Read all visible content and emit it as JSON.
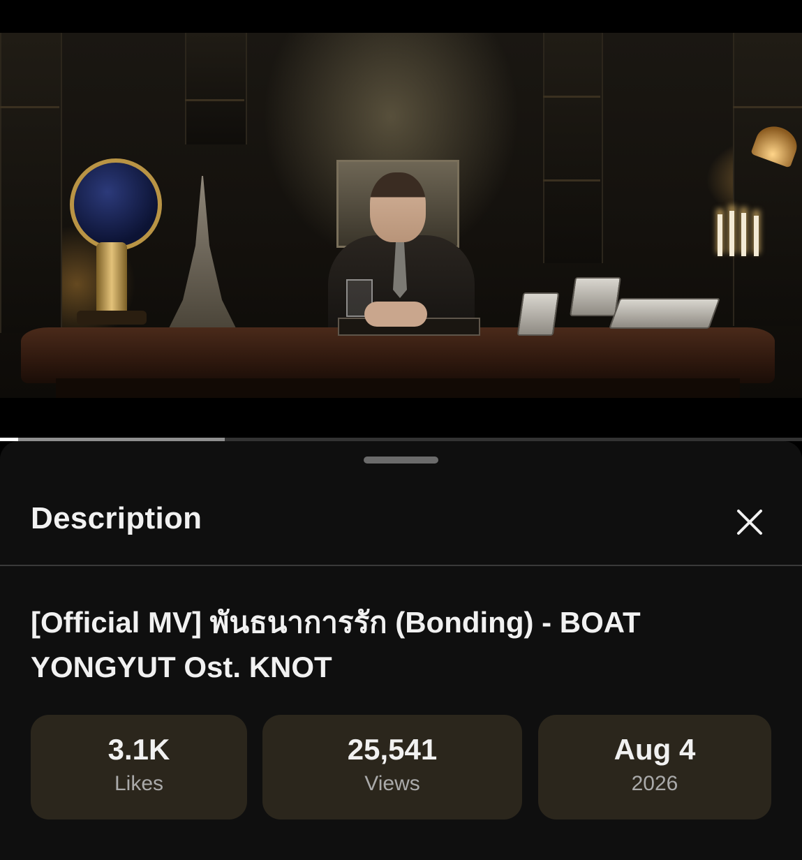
{
  "player": {
    "progress_played_fraction": 0.023,
    "progress_buffered_fraction": 0.28
  },
  "sheet": {
    "title": "Description",
    "close_icon": "close-icon"
  },
  "video": {
    "title": "[Official MV] พันธนาการรัก  (Bonding) - BOAT YONGYUT Ost. KNOT"
  },
  "stats": {
    "likes": {
      "value": "3.1K",
      "label": "Likes"
    },
    "views": {
      "value": "25,541",
      "label": "Views"
    },
    "date": {
      "value": "Aug 4",
      "label": "2026"
    }
  },
  "colors": {
    "sheet_background": "#0f0f0f",
    "stat_card": "#2b261c",
    "text_primary": "#f1f1f1",
    "text_secondary": "#aaaaaa"
  }
}
